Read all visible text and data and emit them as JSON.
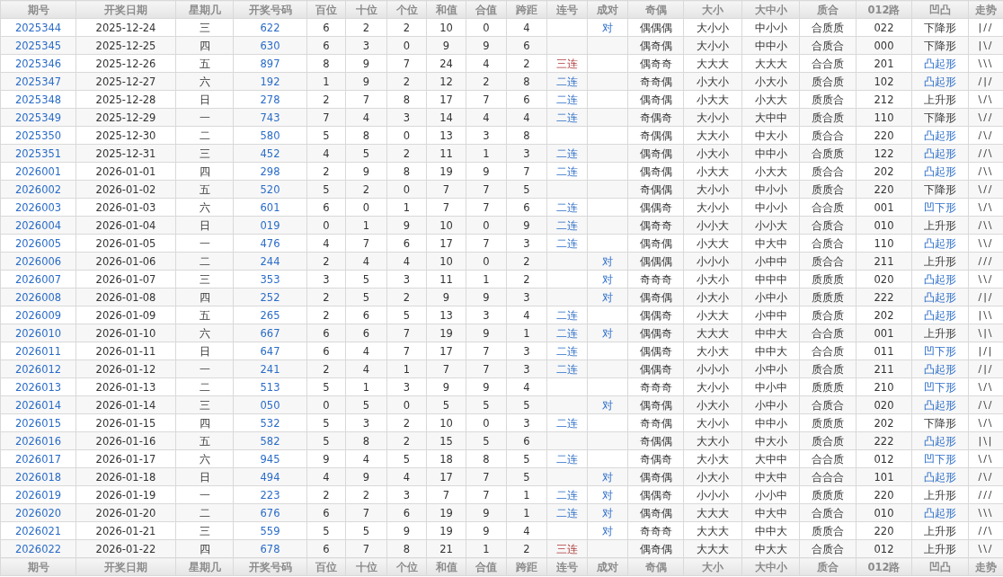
{
  "columns": [
    {
      "label": "期号",
      "kind": "link"
    },
    {
      "label": "开奖日期",
      "kind": "text"
    },
    {
      "label": "星期几",
      "kind": "text"
    },
    {
      "label": "开奖号码",
      "kind": "link"
    },
    {
      "label": "百位",
      "kind": "text"
    },
    {
      "label": "十位",
      "kind": "text"
    },
    {
      "label": "个位",
      "kind": "text"
    },
    {
      "label": "和值",
      "kind": "text"
    },
    {
      "label": "合值",
      "kind": "text"
    },
    {
      "label": "跨距",
      "kind": "text"
    },
    {
      "label": "连号",
      "kind": "text"
    },
    {
      "label": "成对",
      "kind": "text"
    },
    {
      "label": "奇偶",
      "kind": "text"
    },
    {
      "label": "大小",
      "kind": "text"
    },
    {
      "label": "大中小",
      "kind": "text"
    },
    {
      "label": "质合",
      "kind": "text"
    },
    {
      "label": "012路",
      "kind": "text"
    },
    {
      "label": "凹凸",
      "kind": "text"
    },
    {
      "label": "走势",
      "kind": "trend"
    }
  ],
  "rows": [
    [
      "2025344",
      "2025-12-24",
      "三",
      "622",
      "6",
      "2",
      "2",
      "10",
      "0",
      "4",
      null,
      {
        "text": "对",
        "kind": "accent"
      },
      "偶偶偶",
      "大小小",
      "中小小",
      "合质质",
      "022",
      {
        "text": "下降形",
        "kind": "plain"
      },
      "|//"
    ],
    [
      "2025345",
      "2025-12-25",
      "四",
      "630",
      "6",
      "3",
      "0",
      "9",
      "9",
      "6",
      null,
      null,
      "偶奇偶",
      "大小小",
      "中中小",
      "合质合",
      "000",
      {
        "text": "下降形",
        "kind": "plain"
      },
      "|\\/"
    ],
    [
      "2025346",
      "2025-12-26",
      "五",
      "897",
      "8",
      "9",
      "7",
      "24",
      "4",
      "2",
      {
        "text": "三连",
        "kind": "alert"
      },
      null,
      "偶奇奇",
      "大大大",
      "大大大",
      "合合质",
      "201",
      {
        "text": "凸起形",
        "kind": "accent"
      },
      "\\\\\\"
    ],
    [
      "2025347",
      "2025-12-27",
      "六",
      "192",
      "1",
      "9",
      "2",
      "12",
      "2",
      "8",
      {
        "text": "二连",
        "kind": "accent"
      },
      null,
      "奇奇偶",
      "小大小",
      "小大小",
      "质合质",
      "102",
      {
        "text": "凸起形",
        "kind": "accent"
      },
      "/|/"
    ],
    [
      "2025348",
      "2025-12-28",
      "日",
      "278",
      "2",
      "7",
      "8",
      "17",
      "7",
      "6",
      {
        "text": "二连",
        "kind": "accent"
      },
      null,
      "偶奇偶",
      "小大大",
      "小大大",
      "质质合",
      "212",
      {
        "text": "上升形",
        "kind": "plain"
      },
      "\\/\\"
    ],
    [
      "2025349",
      "2025-12-29",
      "一",
      "743",
      "7",
      "4",
      "3",
      "14",
      "4",
      "4",
      {
        "text": "二连",
        "kind": "accent"
      },
      null,
      "奇偶奇",
      "大小小",
      "大中中",
      "质合质",
      "110",
      {
        "text": "下降形",
        "kind": "plain"
      },
      "\\//"
    ],
    [
      "2025350",
      "2025-12-30",
      "二",
      "580",
      "5",
      "8",
      "0",
      "13",
      "3",
      "8",
      null,
      null,
      "奇偶偶",
      "大大小",
      "中大小",
      "质合合",
      "220",
      {
        "text": "凸起形",
        "kind": "accent"
      },
      "/\\/"
    ],
    [
      "2025351",
      "2025-12-31",
      "三",
      "452",
      "4",
      "5",
      "2",
      "11",
      "1",
      "3",
      {
        "text": "二连",
        "kind": "accent"
      },
      null,
      "偶奇偶",
      "小大小",
      "中中小",
      "合质质",
      "122",
      {
        "text": "凸起形",
        "kind": "accent"
      },
      "//\\"
    ],
    [
      "2026001",
      "2026-01-01",
      "四",
      "298",
      "2",
      "9",
      "8",
      "19",
      "9",
      "7",
      {
        "text": "二连",
        "kind": "accent"
      },
      null,
      "偶奇偶",
      "小大大",
      "小大大",
      "质合合",
      "202",
      {
        "text": "凸起形",
        "kind": "accent"
      },
      "/\\\\"
    ],
    [
      "2026002",
      "2026-01-02",
      "五",
      "520",
      "5",
      "2",
      "0",
      "7",
      "7",
      "5",
      null,
      null,
      "奇偶偶",
      "大小小",
      "中小小",
      "质质合",
      "220",
      {
        "text": "下降形",
        "kind": "plain"
      },
      "\\//"
    ],
    [
      "2026003",
      "2026-01-03",
      "六",
      "601",
      "6",
      "0",
      "1",
      "7",
      "7",
      "6",
      {
        "text": "二连",
        "kind": "accent"
      },
      null,
      "偶偶奇",
      "大小小",
      "中小小",
      "合合质",
      "001",
      {
        "text": "凹下形",
        "kind": "accent"
      },
      "\\/\\"
    ],
    [
      "2026004",
      "2026-01-04",
      "日",
      "019",
      "0",
      "1",
      "9",
      "10",
      "0",
      "9",
      {
        "text": "二连",
        "kind": "accent"
      },
      null,
      "偶奇奇",
      "小小大",
      "小小大",
      "合质合",
      "010",
      {
        "text": "上升形",
        "kind": "plain"
      },
      "/\\\\"
    ],
    [
      "2026005",
      "2026-01-05",
      "一",
      "476",
      "4",
      "7",
      "6",
      "17",
      "7",
      "3",
      {
        "text": "二连",
        "kind": "accent"
      },
      null,
      "偶奇偶",
      "小大大",
      "中大中",
      "合质合",
      "110",
      {
        "text": "凸起形",
        "kind": "accent"
      },
      "\\\\/"
    ],
    [
      "2026006",
      "2026-01-06",
      "二",
      "244",
      "2",
      "4",
      "4",
      "10",
      "0",
      "2",
      null,
      {
        "text": "对",
        "kind": "accent"
      },
      "偶偶偶",
      "小小小",
      "小中中",
      "质合合",
      "211",
      {
        "text": "上升形",
        "kind": "plain"
      },
      "///"
    ],
    [
      "2026007",
      "2026-01-07",
      "三",
      "353",
      "3",
      "5",
      "3",
      "11",
      "1",
      "2",
      null,
      {
        "text": "对",
        "kind": "accent"
      },
      "奇奇奇",
      "小大小",
      "中中中",
      "质质质",
      "020",
      {
        "text": "凸起形",
        "kind": "accent"
      },
      "\\\\/"
    ],
    [
      "2026008",
      "2026-01-08",
      "四",
      "252",
      "2",
      "5",
      "2",
      "9",
      "9",
      "3",
      null,
      {
        "text": "对",
        "kind": "accent"
      },
      "偶奇偶",
      "小大小",
      "小中小",
      "质质质",
      "222",
      {
        "text": "凸起形",
        "kind": "accent"
      },
      "/|/"
    ],
    [
      "2026009",
      "2026-01-09",
      "五",
      "265",
      "2",
      "6",
      "5",
      "13",
      "3",
      "4",
      {
        "text": "二连",
        "kind": "accent"
      },
      null,
      "偶偶奇",
      "小大大",
      "小中中",
      "质合质",
      "202",
      {
        "text": "凸起形",
        "kind": "accent"
      },
      "|\\\\"
    ],
    [
      "2026010",
      "2026-01-10",
      "六",
      "667",
      "6",
      "6",
      "7",
      "19",
      "9",
      "1",
      {
        "text": "二连",
        "kind": "accent"
      },
      {
        "text": "对",
        "kind": "accent"
      },
      "偶偶奇",
      "大大大",
      "中中大",
      "合合质",
      "001",
      {
        "text": "上升形",
        "kind": "plain"
      },
      "\\|\\"
    ],
    [
      "2026011",
      "2026-01-11",
      "日",
      "647",
      "6",
      "4",
      "7",
      "17",
      "7",
      "3",
      {
        "text": "二连",
        "kind": "accent"
      },
      null,
      "偶偶奇",
      "大小大",
      "中中大",
      "合合质",
      "011",
      {
        "text": "凹下形",
        "kind": "accent"
      },
      "|/|"
    ],
    [
      "2026012",
      "2026-01-12",
      "一",
      "241",
      "2",
      "4",
      "1",
      "7",
      "7",
      "3",
      {
        "text": "二连",
        "kind": "accent"
      },
      null,
      "偶偶奇",
      "小小小",
      "小中小",
      "质合质",
      "211",
      {
        "text": "凸起形",
        "kind": "accent"
      },
      "/|/"
    ],
    [
      "2026013",
      "2026-01-13",
      "二",
      "513",
      "5",
      "1",
      "3",
      "9",
      "9",
      "4",
      null,
      null,
      "奇奇奇",
      "大小小",
      "中小中",
      "质质质",
      "210",
      {
        "text": "凹下形",
        "kind": "accent"
      },
      "\\/\\"
    ],
    [
      "2026014",
      "2026-01-14",
      "三",
      "050",
      "0",
      "5",
      "0",
      "5",
      "5",
      "5",
      null,
      {
        "text": "对",
        "kind": "accent"
      },
      "偶奇偶",
      "小大小",
      "小中小",
      "合质合",
      "020",
      {
        "text": "凸起形",
        "kind": "accent"
      },
      "/\\/"
    ],
    [
      "2026015",
      "2026-01-15",
      "四",
      "532",
      "5",
      "3",
      "2",
      "10",
      "0",
      "3",
      {
        "text": "二连",
        "kind": "accent"
      },
      null,
      "奇奇偶",
      "大小小",
      "中中小",
      "质质质",
      "202",
      {
        "text": "下降形",
        "kind": "plain"
      },
      "\\/\\"
    ],
    [
      "2026016",
      "2026-01-16",
      "五",
      "582",
      "5",
      "8",
      "2",
      "15",
      "5",
      "6",
      null,
      null,
      "奇偶偶",
      "大大小",
      "中大小",
      "质合质",
      "222",
      {
        "text": "凸起形",
        "kind": "accent"
      },
      "|\\|"
    ],
    [
      "2026017",
      "2026-01-17",
      "六",
      "945",
      "9",
      "4",
      "5",
      "18",
      "8",
      "5",
      {
        "text": "二连",
        "kind": "accent"
      },
      null,
      "奇偶奇",
      "大小大",
      "大中中",
      "合合质",
      "012",
      {
        "text": "凹下形",
        "kind": "accent"
      },
      "\\/\\"
    ],
    [
      "2026018",
      "2026-01-18",
      "日",
      "494",
      "4",
      "9",
      "4",
      "17",
      "7",
      "5",
      null,
      {
        "text": "对",
        "kind": "accent"
      },
      "偶奇偶",
      "小大小",
      "中大中",
      "合合合",
      "101",
      {
        "text": "凸起形",
        "kind": "accent"
      },
      "/\\/"
    ],
    [
      "2026019",
      "2026-01-19",
      "一",
      "223",
      "2",
      "2",
      "3",
      "7",
      "7",
      "1",
      {
        "text": "二连",
        "kind": "accent"
      },
      {
        "text": "对",
        "kind": "accent"
      },
      "偶偶奇",
      "小小小",
      "小小中",
      "质质质",
      "220",
      {
        "text": "上升形",
        "kind": "plain"
      },
      "///"
    ],
    [
      "2026020",
      "2026-01-20",
      "二",
      "676",
      "6",
      "7",
      "6",
      "19",
      "9",
      "1",
      {
        "text": "二连",
        "kind": "accent"
      },
      {
        "text": "对",
        "kind": "accent"
      },
      "偶奇偶",
      "大大大",
      "中大中",
      "合质合",
      "010",
      {
        "text": "凸起形",
        "kind": "accent"
      },
      "\\\\\\"
    ],
    [
      "2026021",
      "2026-01-21",
      "三",
      "559",
      "5",
      "5",
      "9",
      "19",
      "9",
      "4",
      null,
      {
        "text": "对",
        "kind": "accent"
      },
      "奇奇奇",
      "大大大",
      "中中大",
      "质质合",
      "220",
      {
        "text": "上升形",
        "kind": "plain"
      },
      "//\\"
    ],
    [
      "2026022",
      "2026-01-22",
      "四",
      "678",
      "6",
      "7",
      "8",
      "21",
      "1",
      "2",
      {
        "text": "三连",
        "kind": "alert"
      },
      null,
      "偶奇偶",
      "大大大",
      "中大大",
      "合质合",
      "012",
      {
        "text": "上升形",
        "kind": "plain"
      },
      "\\\\/"
    ]
  ],
  "footer": [
    "期号",
    "开奖日期",
    "星期几",
    "开奖号码",
    "百位",
    "十位",
    "个位",
    "和值",
    "合值",
    "跨距",
    "连号",
    "成对",
    "奇偶",
    "大小",
    "大中小",
    "质合",
    "012路",
    "凹凸",
    "走势"
  ]
}
